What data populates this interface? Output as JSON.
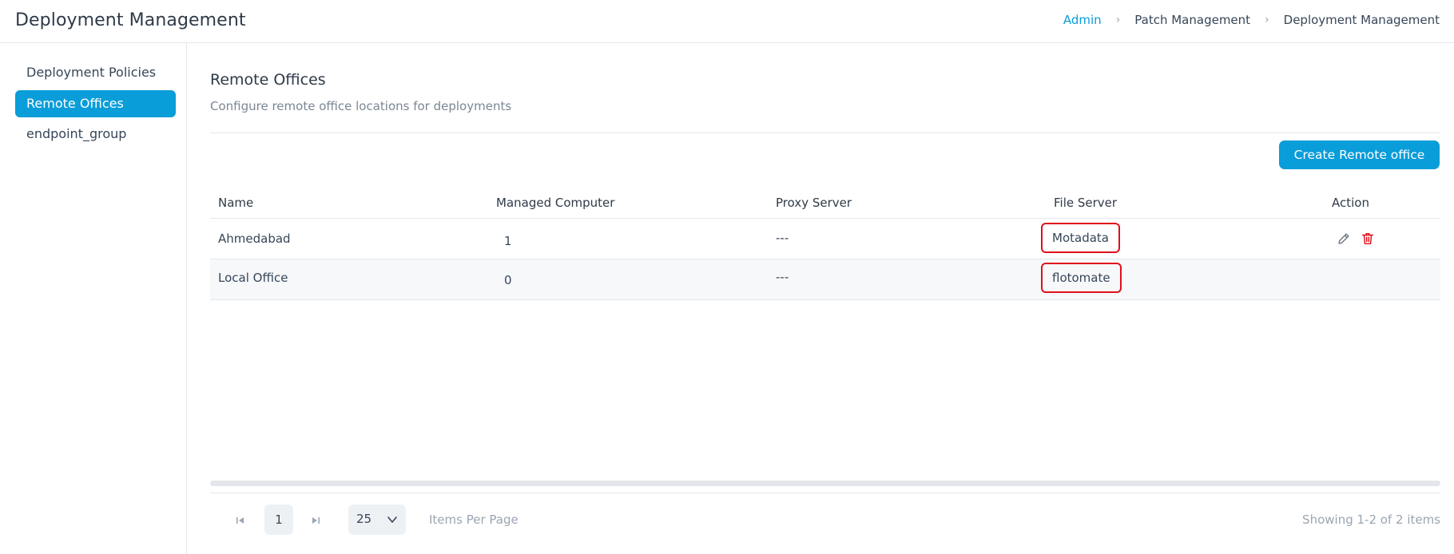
{
  "header": {
    "title": "Deployment Management",
    "breadcrumb": [
      "Admin",
      "Patch Management",
      "Deployment Management"
    ]
  },
  "sidebar": {
    "items": [
      {
        "label": "Deployment Policies",
        "active": false
      },
      {
        "label": "Remote Offices",
        "active": true
      },
      {
        "label": "endpoint_group",
        "active": false
      }
    ]
  },
  "main": {
    "title": "Remote Offices",
    "subtitle": "Configure remote office locations for deployments",
    "create_button": "Create Remote office"
  },
  "table": {
    "columns": [
      "Name",
      "Managed Computer",
      "Proxy Server",
      "File Server",
      "Action"
    ],
    "rows": [
      {
        "name": "Ahmedabad",
        "managed_computer": "1",
        "proxy_server": "---",
        "file_server": "Motadata",
        "actions": [
          "edit-icon",
          "delete-icon"
        ]
      },
      {
        "name": "Local Office",
        "managed_computer": "0",
        "proxy_server": "---",
        "file_server": "flotomate",
        "actions": []
      }
    ]
  },
  "pagination": {
    "current_page": "1",
    "per_page": "25",
    "items_per_page_label": "Items Per Page",
    "showing": "Showing 1-2 of 2 items"
  },
  "colors": {
    "accent": "#099dd9",
    "highlight_border": "#e0101a",
    "delete_icon": "#e0101a"
  }
}
